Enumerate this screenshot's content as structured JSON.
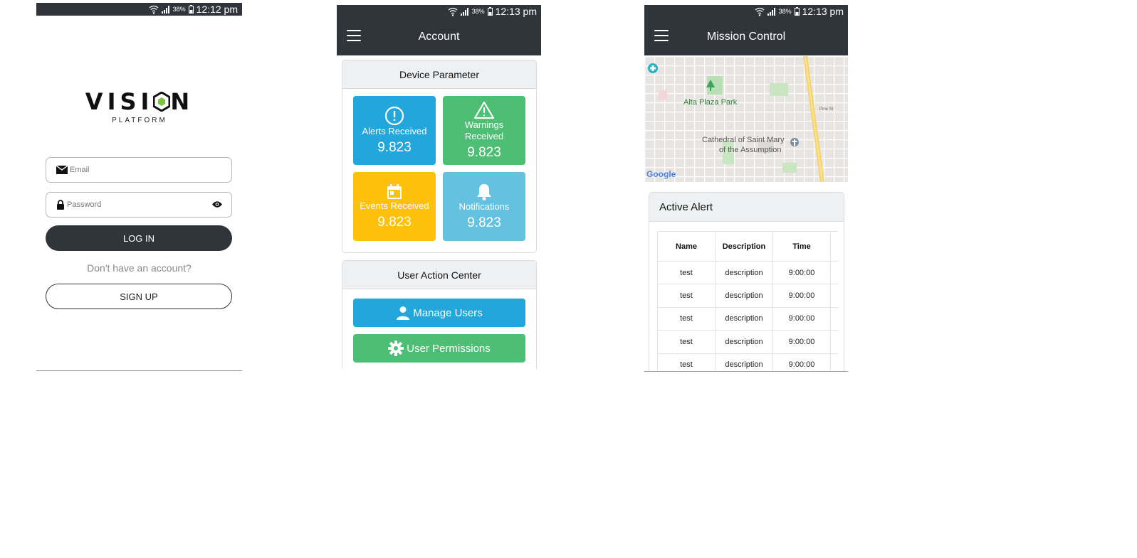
{
  "login": {
    "status_time": "12:12 pm",
    "battery": "38%",
    "logo_word_left": "VISI",
    "logo_word_right": "N",
    "logo_sub": "PLATFORM",
    "email_placeholder": "Email",
    "password_placeholder": "Password",
    "login_label": "LOG IN",
    "no_account": "Don't have an account?",
    "signup_label": "SIGN UP"
  },
  "account": {
    "status_time": "12:13 pm",
    "battery": "38%",
    "title": "Account",
    "device_header": "Device Parameter",
    "tiles": [
      {
        "label": "Alerts Received",
        "value": "9.823",
        "color": "#22a6dc",
        "icon": "alert-circle-icon"
      },
      {
        "label": "Warnings Received",
        "value": "9.823",
        "color": "#4dbe73",
        "icon": "warning-triangle-icon"
      },
      {
        "label": "Events Received",
        "value": "9.823",
        "color": "#fdc10b",
        "icon": "calendar-icon"
      },
      {
        "label": "Notifications",
        "value": "9.823",
        "color": "#65c1e0",
        "icon": "bell-icon"
      }
    ],
    "action_header": "User Action Center",
    "manage_users": "Manage Users",
    "user_permissions": "User Permissions"
  },
  "mission": {
    "status_time": "12:13 pm",
    "battery": "38%",
    "title": "Mission Control",
    "map_labels": {
      "park": "Alta Plaza Park",
      "cathedral_1": "Cathedral of Saint Mary",
      "cathedral_2": "of the Assumption",
      "street": "Pine St",
      "google": "Google"
    },
    "alert_header": "Active Alert",
    "columns": [
      "Name",
      "Description",
      "Time"
    ],
    "rows": [
      [
        "test",
        "description",
        "9:00:00"
      ],
      [
        "test",
        "description",
        "9:00:00"
      ],
      [
        "test",
        "description",
        "9:00:00"
      ],
      [
        "test",
        "description",
        "9:00:00"
      ],
      [
        "test",
        "description",
        "9:00:00"
      ]
    ]
  },
  "colors": {
    "bar": "#30353b",
    "blue": "#22a6dc",
    "green": "#4dbe73",
    "yellow": "#fdc10b",
    "lightblue": "#65c1e0"
  }
}
